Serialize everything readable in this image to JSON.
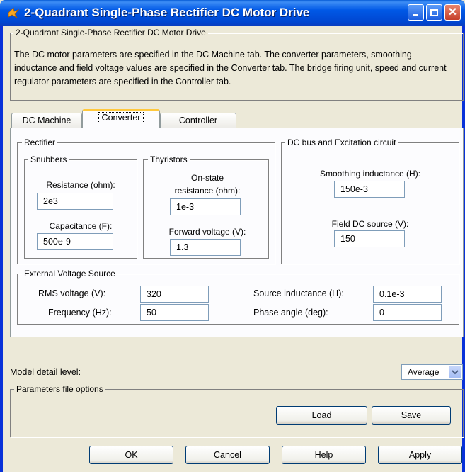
{
  "window": {
    "title": "2-Quadrant Single-Phase Rectifier DC Motor Drive"
  },
  "header_group": {
    "label": "2-Quadrant Single-Phase Rectifier DC Motor Drive",
    "description": "The DC motor parameters are specified in the DC Machine tab. The converter parameters, smoothing inductance and field voltage values are specified in the Converter tab. The bridge firing unit, speed and current regulator parameters are specified in the Controller tab."
  },
  "tabs": [
    {
      "label": "DC Machine",
      "active": false
    },
    {
      "label": "Converter",
      "active": true
    },
    {
      "label": "Controller",
      "active": false
    }
  ],
  "rectifier": {
    "label": "Rectifier",
    "snubbers": {
      "label": "Snubbers",
      "resistance_label": "Resistance (ohm):",
      "resistance_value": "2e3",
      "capacitance_label": "Capacitance (F):",
      "capacitance_value": "500e-9"
    },
    "thyristors": {
      "label": "Thyristors",
      "on_state_label_1": "On-state",
      "on_state_label_2": "resistance (ohm):",
      "on_state_value": "1e-3",
      "forward_voltage_label": "Forward voltage (V):",
      "forward_voltage_value": "1.3"
    }
  },
  "dc_bus": {
    "label": "DC bus and Excitation circuit",
    "smoothing_label": "Smoothing inductance (H):",
    "smoothing_value": "150e-3",
    "field_label": "Field DC source (V):",
    "field_value": "150"
  },
  "external_source": {
    "label": "External Voltage Source",
    "rms_label": "RMS voltage (V):",
    "rms_value": "320",
    "frequency_label": "Frequency (Hz):",
    "frequency_value": "50",
    "source_inductance_label": "Source inductance (H):",
    "source_inductance_value": "0.1e-3",
    "phase_angle_label": "Phase angle (deg):",
    "phase_angle_value": "0"
  },
  "model_detail": {
    "label": "Model detail level:",
    "selected": "Average"
  },
  "params_file": {
    "label": "Parameters file options",
    "load_label": "Load",
    "save_label": "Save"
  },
  "buttons": {
    "ok": "OK",
    "cancel": "Cancel",
    "help": "Help",
    "apply": "Apply"
  },
  "colors": {
    "titlebar": "#0058e6",
    "window_bg": "#ece9d8",
    "tab_highlight": "#ffc83c"
  }
}
